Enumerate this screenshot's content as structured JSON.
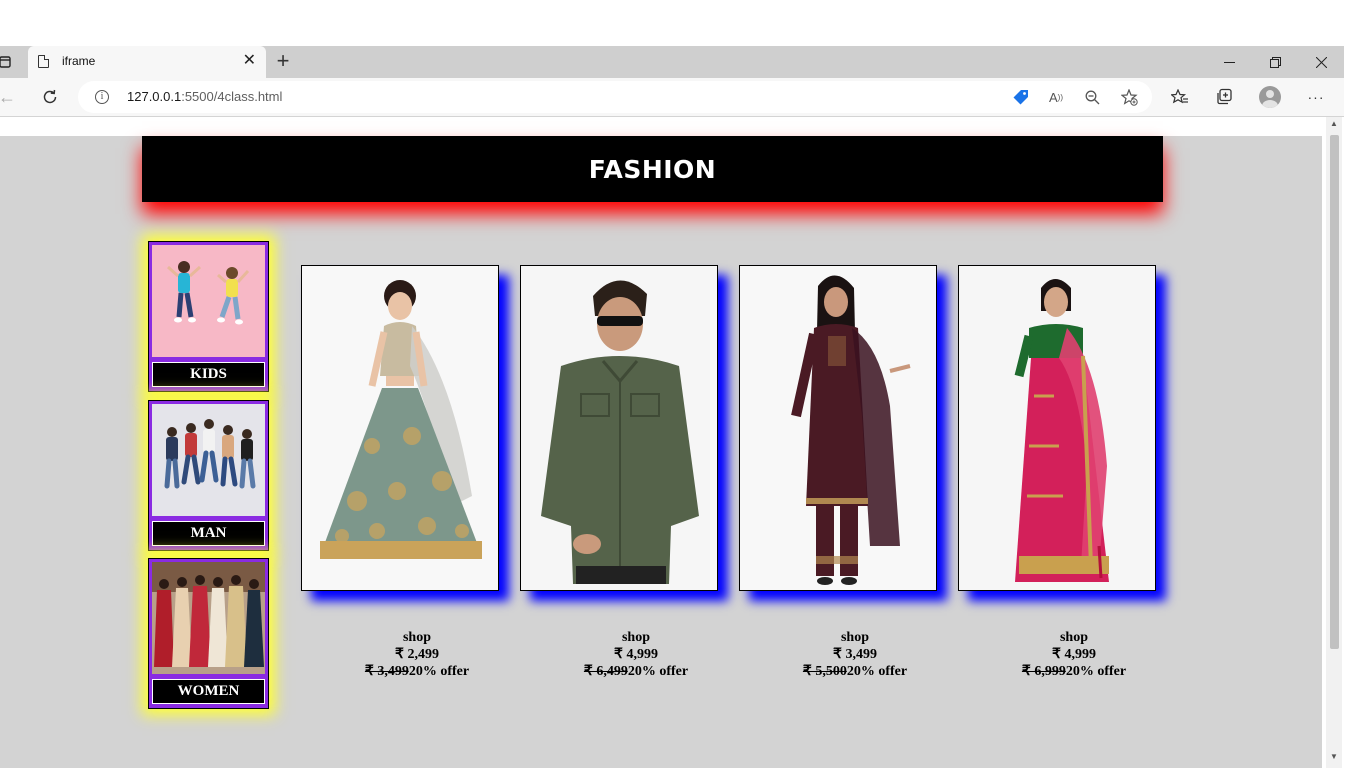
{
  "browser": {
    "tab_title": "iframe",
    "new_tab_label": "+",
    "url_host": "127.0.0.1",
    "url_path": ":5500/4class.html",
    "info_glyph": "i",
    "icons": [
      "page-icon",
      "close-icon",
      "new-tab-icon",
      "minimize-icon",
      "restore-icon",
      "window-close-icon",
      "back-icon",
      "reload-icon",
      "info-icon",
      "coupon-tag-icon",
      "read-aloud-icon",
      "zoom-out-icon",
      "add-favorite-icon",
      "favorites-icon",
      "collections-icon",
      "profile-avatar-icon",
      "more-icon"
    ]
  },
  "page": {
    "header_title": "FASHION",
    "header_shadow_color": "#ff0000",
    "page_background": "#d3d3d3",
    "categories": [
      {
        "label": "KIDS"
      },
      {
        "label": "MAN"
      },
      {
        "label": "WOMEN"
      }
    ],
    "category_frame_color": "#8a2be2",
    "category_glow_color": "#ffff33",
    "product_shadow_color": "#0000ff",
    "products": [
      {
        "name": "lehenga",
        "shop": "shop",
        "price": "₹ 2,499",
        "old_price": "₹ 3,499",
        "offer": "20% offer"
      },
      {
        "name": "shirt",
        "shop": "shop",
        "price": "₹ 4,999",
        "old_price": "₹ 6,499",
        "offer": "20% offer"
      },
      {
        "name": "kurta-set",
        "shop": "shop",
        "price": "₹ 3,499",
        "old_price": "₹ 5,500",
        "offer": "20% offer"
      },
      {
        "name": "saree",
        "shop": "shop",
        "price": "₹ 4,999",
        "old_price": "₹ 6,999",
        "offer": "20% offer"
      }
    ]
  }
}
